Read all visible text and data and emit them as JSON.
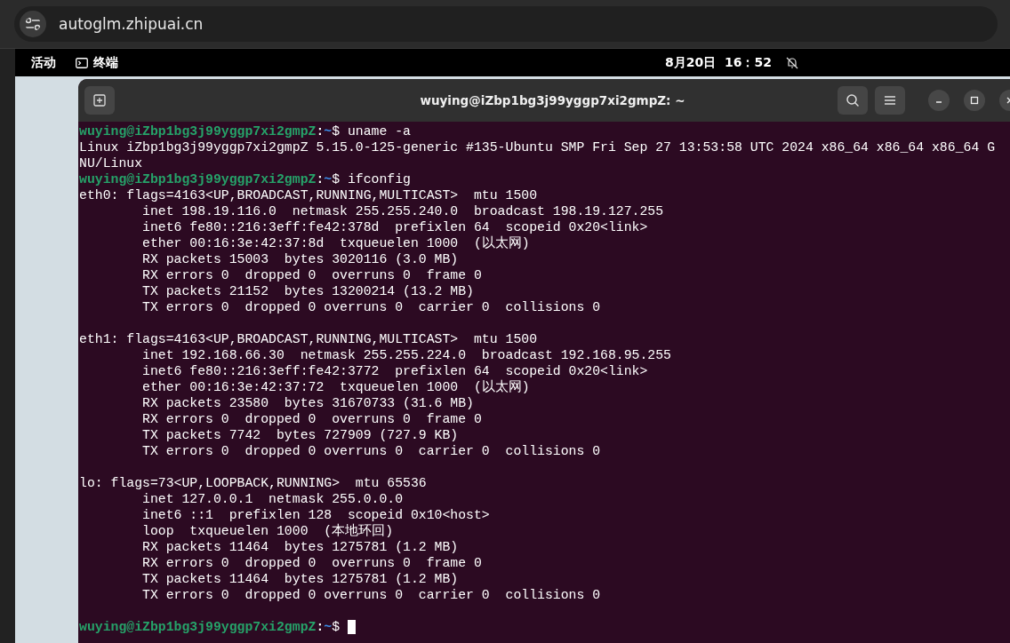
{
  "browser": {
    "url": "autoglm.zhipuai.cn"
  },
  "top_bar": {
    "activities": "活动",
    "app": "终端",
    "clock": "8月20日  16：52"
  },
  "window": {
    "title": "wuying@iZbp1bg3j99yggp7xi2gmpZ: ~"
  },
  "terminal": {
    "lines": [
      {
        "kind": "prompt",
        "user_host": "wuying@iZbp1bg3j99yggp7xi2gmpZ",
        "separator": ":",
        "path": "~",
        "symbol": "$",
        "command": " uname -a"
      },
      {
        "kind": "output",
        "text": "Linux iZbp1bg3j99yggp7xi2gmpZ 5.15.0-125-generic #135-Ubuntu SMP Fri Sep 27 13:53:58 UTC 2024 x86_64 x86_64 x86_64 G"
      },
      {
        "kind": "output",
        "text": "NU/Linux"
      },
      {
        "kind": "prompt",
        "user_host": "wuying@iZbp1bg3j99yggp7xi2gmpZ",
        "separator": ":",
        "path": "~",
        "symbol": "$",
        "command": " ifconfig"
      },
      {
        "kind": "output",
        "text": "eth0: flags=4163<UP,BROADCAST,RUNNING,MULTICAST>  mtu 1500"
      },
      {
        "kind": "output",
        "text": "        inet 198.19.116.0  netmask 255.255.240.0  broadcast 198.19.127.255"
      },
      {
        "kind": "output",
        "text": "        inet6 fe80::216:3eff:fe42:378d  prefixlen 64  scopeid 0x20<link>"
      },
      {
        "kind": "output",
        "text": "        ether 00:16:3e:42:37:8d  txqueuelen 1000  (以太网)"
      },
      {
        "kind": "output",
        "text": "        RX packets 15003  bytes 3020116 (3.0 MB)"
      },
      {
        "kind": "output",
        "text": "        RX errors 0  dropped 0  overruns 0  frame 0"
      },
      {
        "kind": "output",
        "text": "        TX packets 21152  bytes 13200214 (13.2 MB)"
      },
      {
        "kind": "output",
        "text": "        TX errors 0  dropped 0 overruns 0  carrier 0  collisions 0"
      },
      {
        "kind": "blank"
      },
      {
        "kind": "output",
        "text": "eth1: flags=4163<UP,BROADCAST,RUNNING,MULTICAST>  mtu 1500"
      },
      {
        "kind": "output",
        "text": "        inet 192.168.66.30  netmask 255.255.224.0  broadcast 192.168.95.255"
      },
      {
        "kind": "output",
        "text": "        inet6 fe80::216:3eff:fe42:3772  prefixlen 64  scopeid 0x20<link>"
      },
      {
        "kind": "output",
        "text": "        ether 00:16:3e:42:37:72  txqueuelen 1000  (以太网)"
      },
      {
        "kind": "output",
        "text": "        RX packets 23580  bytes 31670733 (31.6 MB)"
      },
      {
        "kind": "output",
        "text": "        RX errors 0  dropped 0  overruns 0  frame 0"
      },
      {
        "kind": "output",
        "text": "        TX packets 7742  bytes 727909 (727.9 KB)"
      },
      {
        "kind": "output",
        "text": "        TX errors 0  dropped 0 overruns 0  carrier 0  collisions 0"
      },
      {
        "kind": "blank"
      },
      {
        "kind": "output",
        "text": "lo: flags=73<UP,LOOPBACK,RUNNING>  mtu 65536"
      },
      {
        "kind": "output",
        "text": "        inet 127.0.0.1  netmask 255.0.0.0"
      },
      {
        "kind": "output",
        "text": "        inet6 ::1  prefixlen 128  scopeid 0x10<host>"
      },
      {
        "kind": "output",
        "text": "        loop  txqueuelen 1000  (本地环回)"
      },
      {
        "kind": "output",
        "text": "        RX packets 11464  bytes 1275781 (1.2 MB)"
      },
      {
        "kind": "output",
        "text": "        RX errors 0  dropped 0  overruns 0  frame 0"
      },
      {
        "kind": "output",
        "text": "        TX packets 11464  bytes 1275781 (1.2 MB)"
      },
      {
        "kind": "output",
        "text": "        TX errors 0  dropped 0 overruns 0  carrier 0  collisions 0"
      },
      {
        "kind": "blank"
      },
      {
        "kind": "prompt",
        "user_host": "wuying@iZbp1bg3j99yggp7xi2gmpZ",
        "separator": ":",
        "path": "~",
        "symbol": "$",
        "cursor": true
      }
    ]
  }
}
